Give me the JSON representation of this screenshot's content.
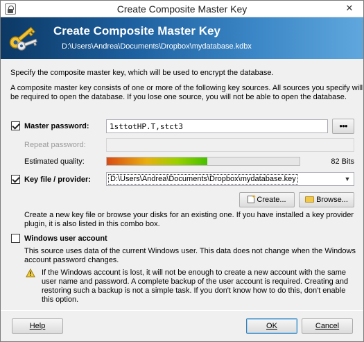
{
  "window": {
    "title": "Create Composite Master Key",
    "close_glyph": "✕"
  },
  "banner": {
    "title": "Create Composite Master Key",
    "subtitle": "D:\\Users\\Andrea\\Documents\\Dropbox\\mydatabase.kdbx",
    "icon": "keys-icon"
  },
  "intro": {
    "line1": "Specify the composite master key, which will be used to encrypt the database.",
    "line2": "A composite master key consists of one or more of the following key sources. All sources you specify will",
    "line3": "be required to open the database.  If you lose one source, you will not be able to open the database."
  },
  "master_password": {
    "label": "Master password:",
    "checked": true,
    "value": "1sttotHP.T,stct3",
    "reveal_button": "●●●",
    "repeat_label": "Repeat password:",
    "repeat_value": "",
    "quality_label": "Estimated quality:",
    "quality_fraction": 0.52,
    "quality_text": "82 Bits"
  },
  "key_file": {
    "label": "Key file / provider:",
    "checked": true,
    "selected": "D:\\Users\\Andrea\\Documents\\Dropbox\\mydatabase.key",
    "create_button": "Create...",
    "browse_button": "Browse...",
    "help1": "Create a new key file or browse your disks for an existing one. If you have installed a key provider",
    "help2": "plugin, it is also listed in this combo box."
  },
  "windows_account": {
    "label": "Windows user account",
    "checked": false,
    "desc1": "This source uses data of the current Windows user. This data does not change when the Windows",
    "desc2": "account password changes.",
    "warn1": "If the Windows account is lost, it will not be enough to create a new account with the same",
    "warn2": "user name and password. A complete backup of the user account is required. Creating and",
    "warn3": "restoring such a backup is not a simple task. If you don't know how to do this, don't enable",
    "warn4": "this option."
  },
  "footer": {
    "help": "Help",
    "ok": "OK",
    "cancel": "Cancel"
  },
  "colors": {
    "banner_dark": "#0c3864",
    "banner_light": "#5fa7dd",
    "quality_high": "#46c000"
  }
}
